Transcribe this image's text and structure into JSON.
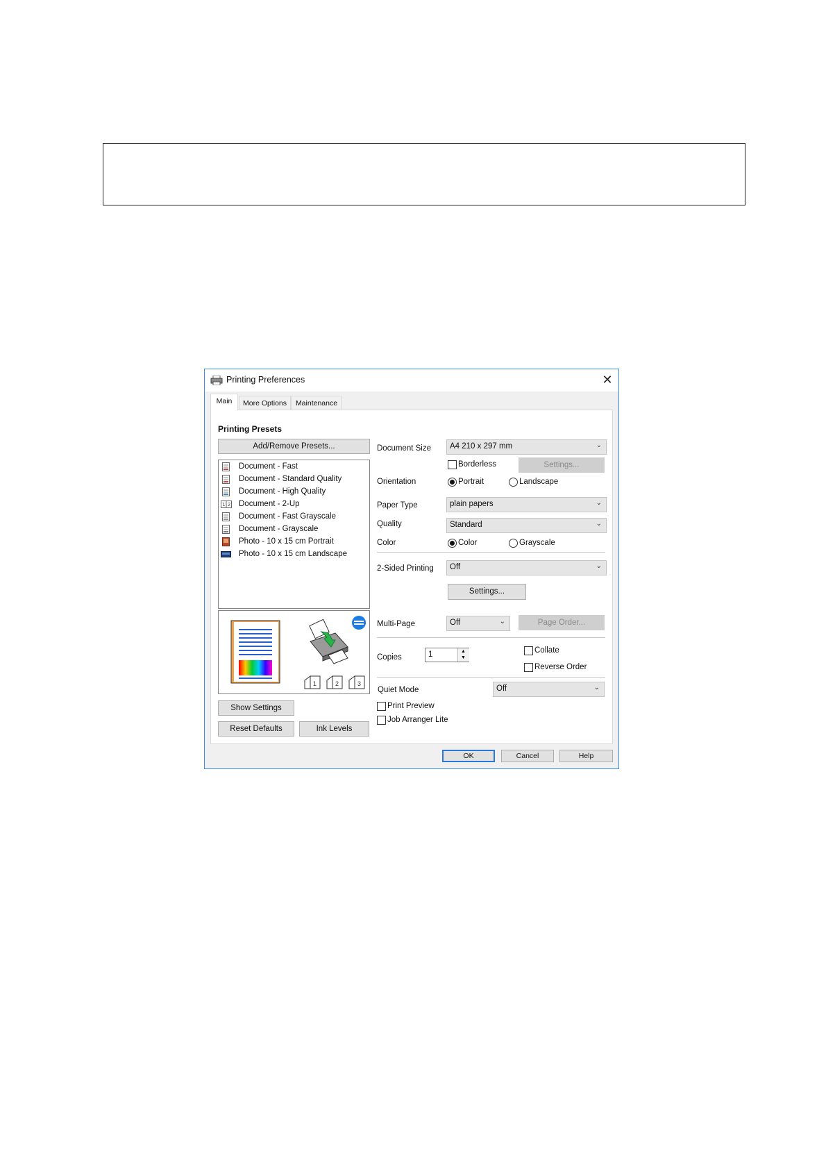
{
  "dialog": {
    "title": "Printing Preferences",
    "tabs": [
      {
        "label": "Main",
        "active": true
      },
      {
        "label": "More Options",
        "active": false
      },
      {
        "label": "Maintenance",
        "active": false
      }
    ],
    "presets": {
      "title": "Printing Presets",
      "add_remove_label": "Add/Remove Presets...",
      "items": [
        {
          "label": "Document - Fast",
          "icon": "document-icon"
        },
        {
          "label": "Document - Standard Quality",
          "icon": "document-icon"
        },
        {
          "label": "Document - High Quality",
          "icon": "document-icon"
        },
        {
          "label": "Document - 2-Up",
          "icon": "two-up-icon"
        },
        {
          "label": "Document - Fast Grayscale",
          "icon": "document-icon"
        },
        {
          "label": "Document - Grayscale",
          "icon": "document-icon"
        },
        {
          "label": "Photo - 10 x 15 cm Portrait",
          "icon": "photo-icon"
        },
        {
          "label": "Photo - 10 x 15 cm Landscape",
          "icon": "photo-landscape-icon"
        }
      ]
    },
    "show_settings_label": "Show Settings",
    "reset_defaults_label": "Reset Defaults",
    "ink_levels_label": "Ink Levels",
    "document_size": {
      "label": "Document Size",
      "value": "A4 210 x 297 mm"
    },
    "borderless": {
      "label": "Borderless",
      "checked": false
    },
    "borderless_settings_label": "Settings...",
    "orientation": {
      "label": "Orientation",
      "portrait": "Portrait",
      "landscape": "Landscape",
      "selected": "Portrait"
    },
    "paper_type": {
      "label": "Paper Type",
      "value": "plain papers"
    },
    "quality": {
      "label": "Quality",
      "value": "Standard"
    },
    "color": {
      "label": "Color",
      "color": "Color",
      "grayscale": "Grayscale",
      "selected": "Color"
    },
    "two_sided": {
      "label": "2-Sided Printing",
      "value": "Off",
      "settings_label": "Settings..."
    },
    "multi_page": {
      "label": "Multi-Page",
      "value": "Off",
      "page_order_label": "Page Order..."
    },
    "copies": {
      "label": "Copies",
      "value": "1"
    },
    "collate": {
      "label": "Collate",
      "checked": false
    },
    "reverse_order": {
      "label": "Reverse Order",
      "checked": false
    },
    "quiet_mode": {
      "label": "Quiet Mode",
      "value": "Off"
    },
    "print_preview": {
      "label": "Print Preview",
      "checked": false
    },
    "job_arranger": {
      "label": "Job Arranger Lite",
      "checked": false
    },
    "ok_label": "OK",
    "cancel_label": "Cancel",
    "help_label": "Help"
  },
  "colors": {
    "accent": "#2a78d8",
    "window_border": "#3a8ee6"
  }
}
